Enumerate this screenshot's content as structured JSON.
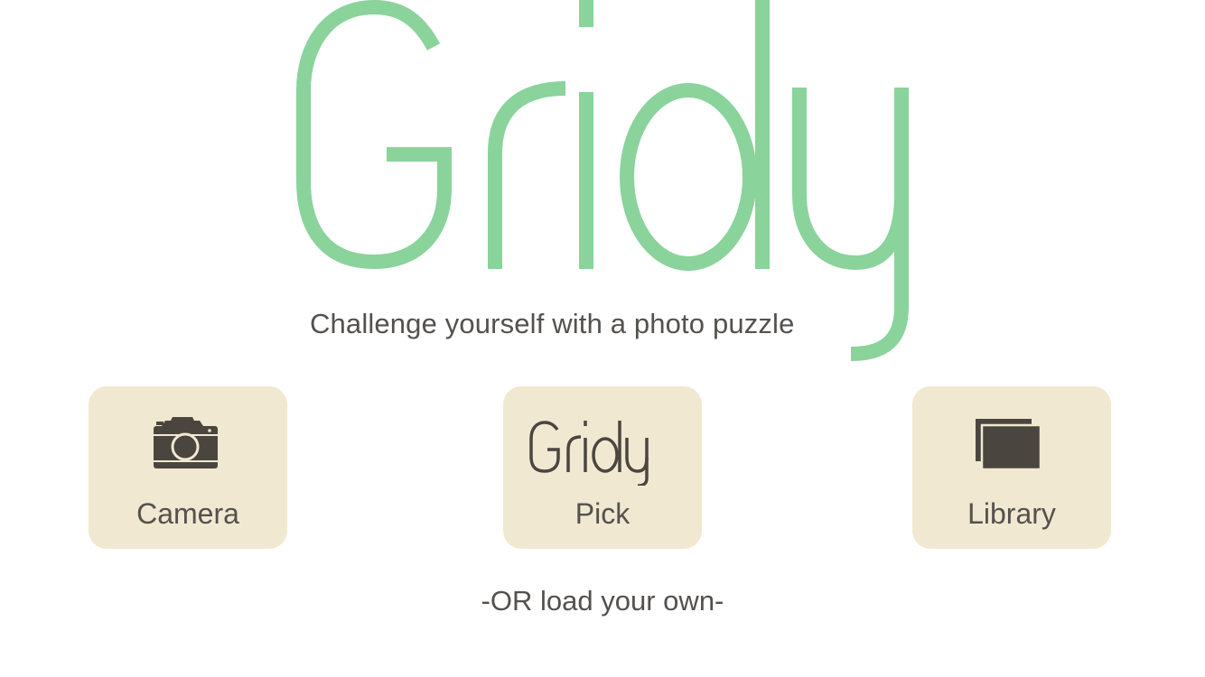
{
  "app": {
    "logo_text": "Gridy",
    "tagline": "Challenge yourself with a photo puzzle",
    "logo_color": "#8ad39b"
  },
  "actions": [
    {
      "label": "Camera",
      "icon": "camera-icon"
    },
    {
      "label": "Pick",
      "icon": "gridy-logo-icon"
    },
    {
      "label": "Library",
      "icon": "photo-library-icon"
    }
  ],
  "footer": {
    "text": "-OR load your own-"
  },
  "colors": {
    "background": "#ffffff",
    "tile_background": "#f1e8d2",
    "text": "#54514d",
    "icon": "#4a463f"
  }
}
